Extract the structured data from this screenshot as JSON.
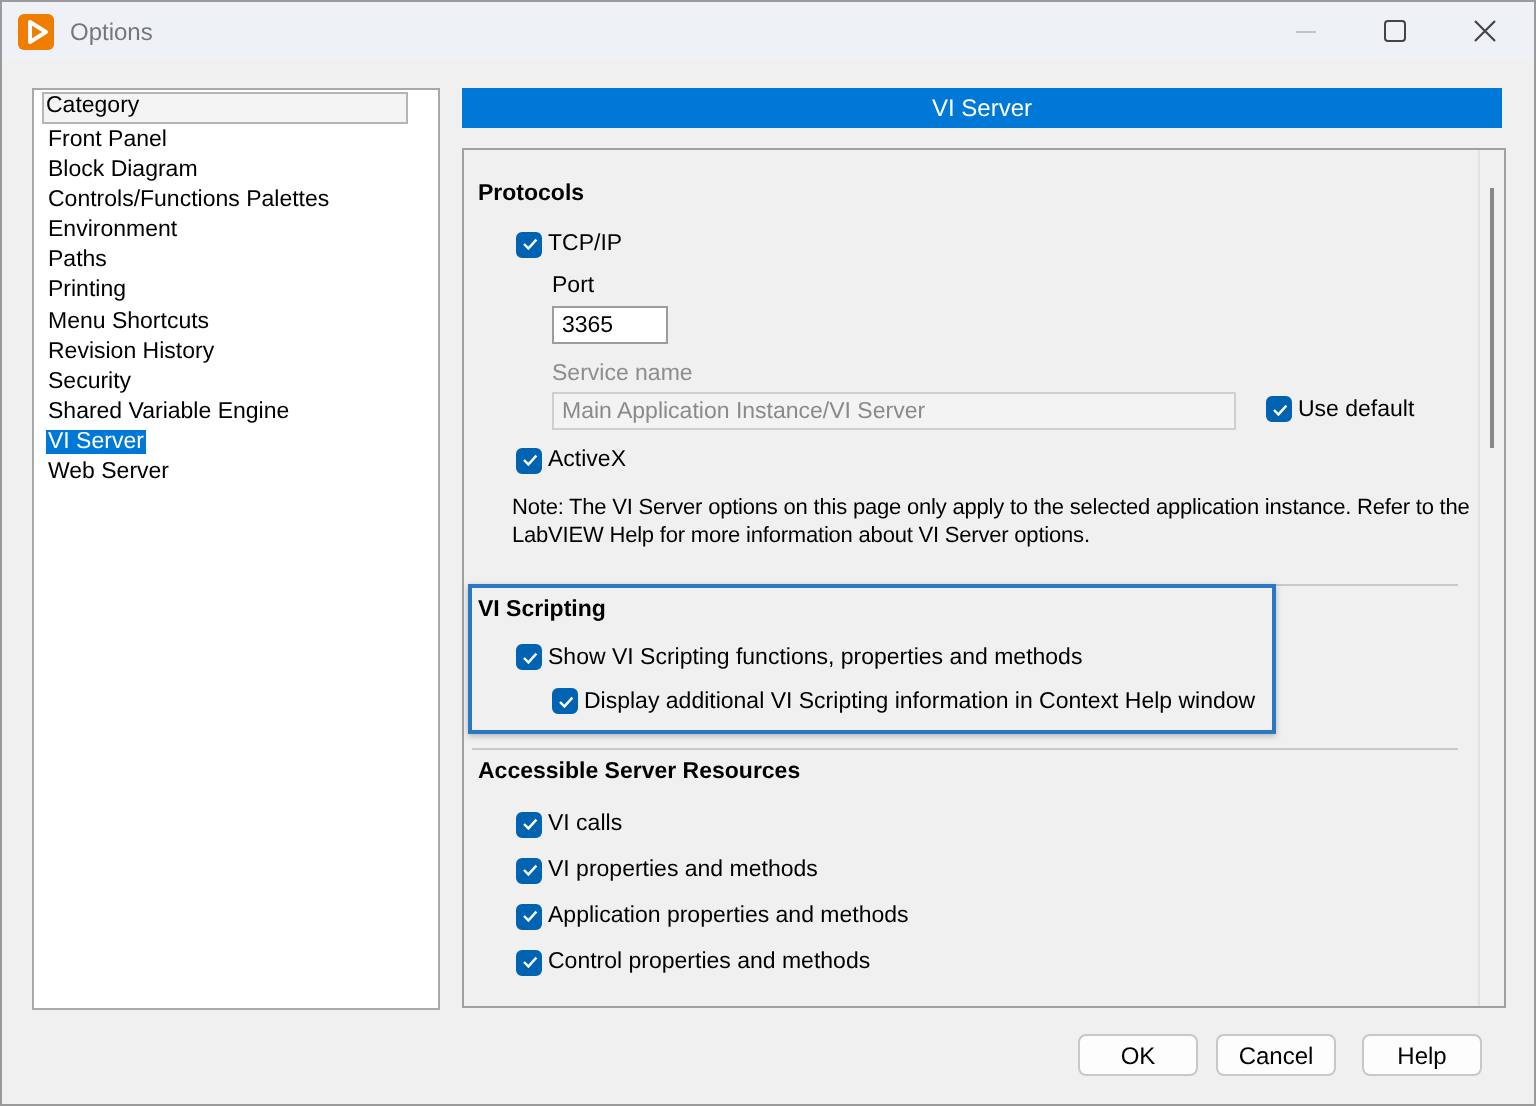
{
  "window": {
    "title": "Options"
  },
  "sidebar": {
    "header": "Category",
    "items": [
      {
        "label": "Front Panel",
        "selected": false
      },
      {
        "label": "Block Diagram",
        "selected": false
      },
      {
        "label": "Controls/Functions Palettes",
        "selected": false
      },
      {
        "label": "Environment",
        "selected": false
      },
      {
        "label": "Paths",
        "selected": false
      },
      {
        "label": "Printing",
        "selected": false
      },
      {
        "label": "Menu Shortcuts",
        "selected": false
      },
      {
        "label": "Revision History",
        "selected": false
      },
      {
        "label": "Security",
        "selected": false
      },
      {
        "label": "Shared Variable Engine",
        "selected": false
      },
      {
        "label": "VI Server",
        "selected": true
      },
      {
        "label": "Web Server",
        "selected": false
      }
    ]
  },
  "panel": {
    "title": "VI Server"
  },
  "protocols": {
    "title": "Protocols",
    "tcpip": {
      "label": "TCP/IP",
      "checked": true
    },
    "port": {
      "label": "Port",
      "value": "3365"
    },
    "service_name": {
      "label": "Service name",
      "value": "Main Application Instance/VI Server",
      "disabled": true
    },
    "use_default": {
      "label": "Use default",
      "checked": true
    },
    "activex": {
      "label": "ActiveX",
      "checked": true
    },
    "note": "Note: The VI Server options on this page only apply to the selected application instance. Refer to the LabVIEW Help for more information about VI Server options."
  },
  "vi_scripting": {
    "title": "VI Scripting",
    "highlighted": true,
    "options": [
      {
        "label": "Show VI Scripting functions, properties and methods",
        "checked": true,
        "children": [
          {
            "label": "Display additional VI Scripting information in Context Help window",
            "checked": true
          }
        ]
      }
    ]
  },
  "accessible_server_resources": {
    "title": "Accessible Server Resources",
    "options": [
      {
        "label": "VI calls",
        "checked": true
      },
      {
        "label": "VI properties and methods",
        "checked": true
      },
      {
        "label": "Application properties and methods",
        "checked": true
      },
      {
        "label": "Control properties and methods",
        "checked": true
      }
    ]
  },
  "buttons": [
    {
      "label": "OK"
    },
    {
      "label": "Cancel"
    },
    {
      "label": "Help"
    }
  ]
}
